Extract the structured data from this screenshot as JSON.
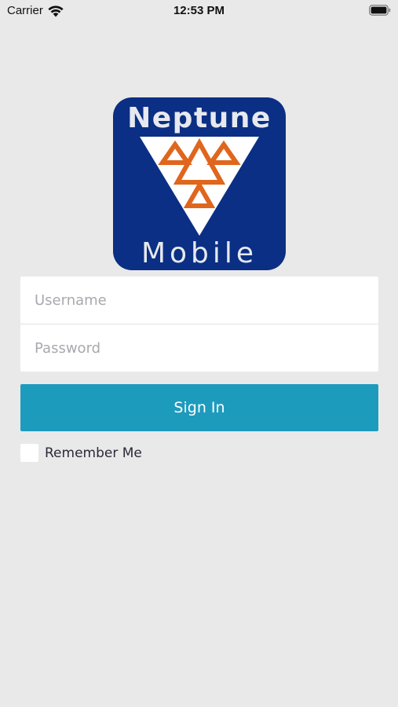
{
  "status_bar": {
    "carrier": "Carrier",
    "time": "12:53 PM",
    "wifi_icon": "wifi-icon",
    "battery_icon": "battery-icon"
  },
  "logo": {
    "top_text": "Neptune",
    "bottom_text": "Mobile",
    "colors": {
      "background": "#0a2f84",
      "triangle": "#ffffff",
      "accent": "#e0651d",
      "text": "#e6e9ef"
    }
  },
  "login": {
    "username_placeholder": "Username",
    "username_value": "",
    "password_placeholder": "Password",
    "password_value": "",
    "sign_in_label": "Sign In",
    "remember_label": "Remember Me",
    "remember_checked": false
  },
  "colors": {
    "background": "#e9e9e9",
    "primary": "#1d9bbd"
  }
}
